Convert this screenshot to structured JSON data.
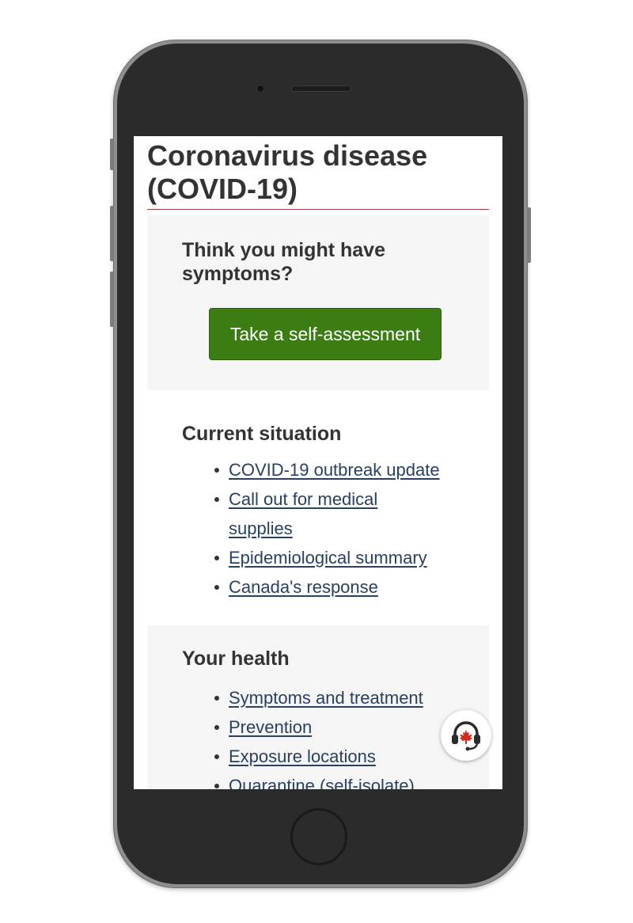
{
  "page": {
    "title": "Coronavirus disease (COVID-19)"
  },
  "symptoms_panel": {
    "heading": "Think you might have symptoms?",
    "button_label": "Take a self-assessment"
  },
  "current_situation": {
    "heading": "Current situation",
    "links": [
      "COVID-19 outbreak update",
      "Call out for medical supplies",
      "Epidemiological summary",
      "Canada's response"
    ]
  },
  "your_health": {
    "heading": "Your health",
    "links": [
      "Symptoms and treatment",
      "Prevention",
      "Exposure locations",
      "Quarantine (self-isolate)"
    ]
  },
  "chat_button": {
    "icon": "headset-maple-leaf-icon"
  },
  "colors": {
    "accent_rule": "#af3c43",
    "button_green": "#3b7d12",
    "link": "#284162",
    "panel_bg": "#f5f5f5",
    "maple_red": "#d52b1e"
  }
}
